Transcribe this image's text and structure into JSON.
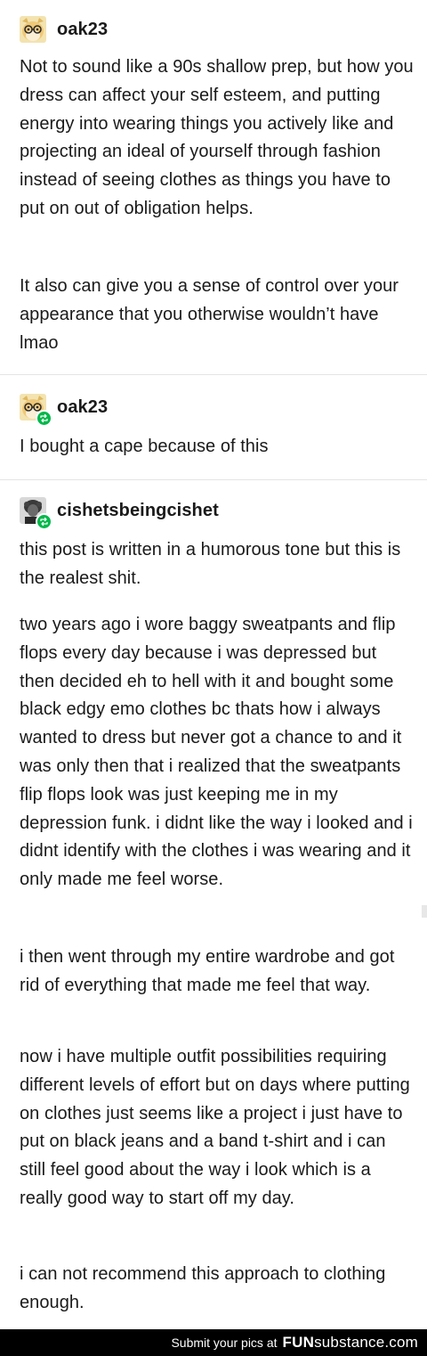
{
  "colors": {
    "reblog_badge": "#00b84a",
    "footer_background": "#000000",
    "divider": "#e4e4e4"
  },
  "posts": [
    {
      "username": "oak23",
      "avatar_icon": "avatar-oak23-icon",
      "reblog": false,
      "paragraphs": [
        "Not to sound like a 90s shallow prep, but how you dress can affect your self esteem, and putting energy into wearing things you actively like and projecting an ideal of yourself through fashion instead of seeing clothes as things you have to put on out of obligation helps.",
        "It also can give you a sense of control over your appearance that you otherwise wouldn’t have lmao"
      ]
    },
    {
      "username": "oak23",
      "avatar_icon": "avatar-oak23-icon",
      "reblog": true,
      "paragraphs": [
        "I bought a cape because of this"
      ]
    },
    {
      "username": "cishetsbeingcishet",
      "avatar_icon": "avatar-cishetsbeingcishet-icon",
      "reblog": true,
      "paragraphs": [
        "this post is written in a humorous tone but this is the realest shit.",
        "two years ago i wore baggy sweatpants and flip flops every day because i was depressed but then decided eh to hell with it and bought some black edgy emo clothes bc thats how i always wanted to dress but never got a chance to and it was only then that i realized that the sweatpants flip flops look was just keeping me in my depression funk. i didnt like the way i looked and i didnt identify with the clothes i was wearing and it only made me feel worse.",
        "i then went through my entire wardrobe and got rid of everything that made me feel that way.",
        "now i have multiple outfit possibilities requiring different levels of effort but on days where putting on clothes just seems like a project i just have to put on black jeans and a band t-shirt and i can still feel good about the way i look which is a really good way to start off my day.",
        "i can not recommend this approach to clothing enough."
      ]
    }
  ],
  "footer": {
    "text": "Submit your pics at",
    "brand_part1": "FUN",
    "brand_part2": "substance",
    "brand_part3": ".com"
  }
}
